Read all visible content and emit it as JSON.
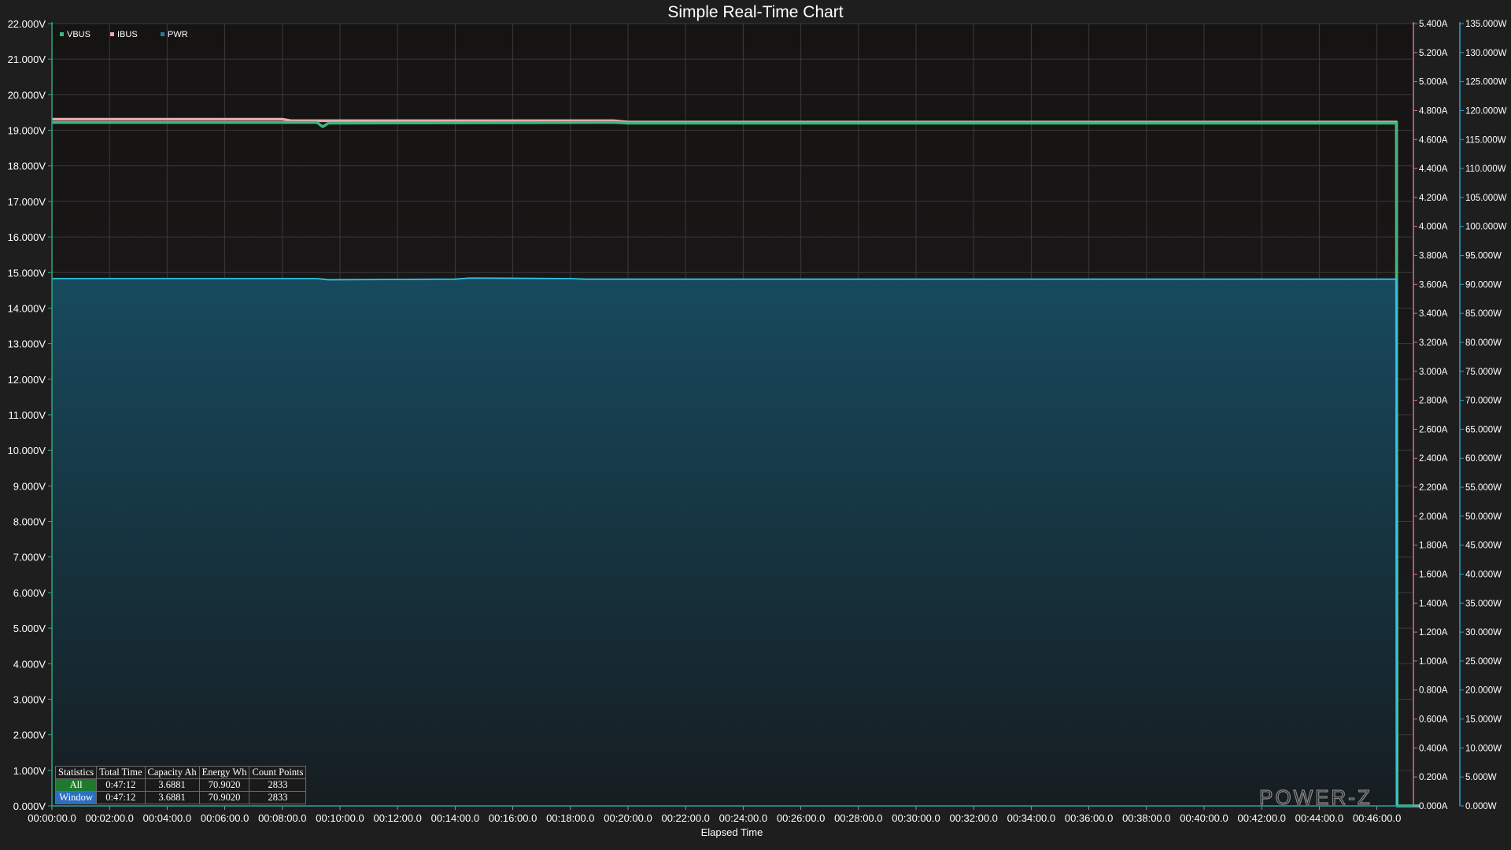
{
  "window": {
    "title": "Simple Real-Time Chart"
  },
  "colors": {
    "background": "#1e1e1e",
    "plot_background_top": "#161313",
    "vbus": "#3db87a",
    "ibus": "#e8a8b4",
    "pwr": "#33c4e8",
    "pwr_fill": "#1a5a70",
    "left_axis": "#2aa880",
    "right_axis_a": "#d07090",
    "right_axis_w": "#2aa0d0"
  },
  "chart_data": {
    "type": "area",
    "title": "Simple Real-Time Chart",
    "xlabel": "Elapsed Time",
    "ylabel": "",
    "x_ticks": [
      "00:00:00.0",
      "00:02:00.0",
      "00:04:00.0",
      "00:06:00.0",
      "00:08:00.0",
      "00:10:00.0",
      "00:12:00.0",
      "00:14:00.0",
      "00:16:00.0",
      "00:18:00.0",
      "00:20:00.0",
      "00:22:00.0",
      "00:24:00.0",
      "00:26:00.0",
      "00:28:00.0",
      "00:30:00.0",
      "00:32:00.0",
      "00:34:00.0",
      "00:36:00.0",
      "00:38:00.0",
      "00:40:00.0",
      "00:42:00.0",
      "00:44:00.0",
      "00:46:00.0"
    ],
    "x_range_minutes": [
      0,
      47.5
    ],
    "grid": true,
    "legend_position": "top-left",
    "y_axes": [
      {
        "id": "voltage",
        "side": "left",
        "unit": "V",
        "range": [
          0,
          22
        ],
        "ticks": [
          "0.000V",
          "1.000V",
          "2.000V",
          "3.000V",
          "4.000V",
          "5.000V",
          "6.000V",
          "7.000V",
          "8.000V",
          "9.000V",
          "10.000V",
          "11.000V",
          "12.000V",
          "13.000V",
          "14.000V",
          "15.000V",
          "16.000V",
          "17.000V",
          "18.000V",
          "19.000V",
          "20.000V",
          "21.000V",
          "22.000V"
        ]
      },
      {
        "id": "current",
        "side": "right",
        "unit": "A",
        "range": [
          0,
          5.4
        ],
        "ticks": [
          "0.000A",
          "0.200A",
          "0.400A",
          "0.600A",
          "0.800A",
          "1.000A",
          "1.200A",
          "1.400A",
          "1.600A",
          "1.800A",
          "2.000A",
          "2.200A",
          "2.400A",
          "2.600A",
          "2.800A",
          "3.000A",
          "3.200A",
          "3.400A",
          "3.600A",
          "3.800A",
          "4.000A",
          "4.200A",
          "4.400A",
          "4.600A",
          "4.800A",
          "5.000A",
          "5.200A",
          "5.400A"
        ]
      },
      {
        "id": "power",
        "side": "right",
        "unit": "W",
        "range": [
          0,
          135
        ],
        "ticks": [
          "0.000W",
          "5.000W",
          "10.000W",
          "15.000W",
          "20.000W",
          "25.000W",
          "30.000W",
          "35.000W",
          "40.000W",
          "45.000W",
          "50.000W",
          "55.000W",
          "60.000W",
          "65.000W",
          "70.000W",
          "75.000W",
          "80.000W",
          "85.000W",
          "90.000W",
          "95.000W",
          "100.000W",
          "105.000W",
          "110.000W",
          "115.000W",
          "120.000W",
          "125.000W",
          "130.000W",
          "135.000W"
        ]
      }
    ],
    "series": [
      {
        "name": "VBUS",
        "axis": "voltage",
        "x": [
          0,
          9.2,
          9.4,
          9.6,
          19.5,
          20,
          46.68,
          46.7,
          47.5
        ],
        "values": [
          19.22,
          19.22,
          19.1,
          19.2,
          19.22,
          19.2,
          19.2,
          0,
          0
        ]
      },
      {
        "name": "IBUS",
        "axis": "current",
        "x": [
          0,
          8,
          8.3,
          19.5,
          20,
          46.68,
          46.7,
          47.5
        ],
        "values": [
          4.74,
          4.74,
          4.73,
          4.73,
          4.72,
          4.72,
          0,
          0
        ]
      },
      {
        "name": "PWR",
        "axis": "power",
        "x": [
          0,
          9.2,
          9.6,
          14,
          14.5,
          18,
          18.5,
          46.68,
          46.7,
          47.5
        ],
        "values": [
          91.0,
          91.0,
          90.8,
          90.9,
          91.1,
          91.0,
          90.9,
          90.9,
          0,
          0
        ]
      }
    ]
  },
  "legend": {
    "items": [
      {
        "label": "VBUS",
        "color": "#3db87a"
      },
      {
        "label": "IBUS",
        "color": "#e8a8b4"
      },
      {
        "label": "PWR",
        "color": "#2a7aa0"
      }
    ]
  },
  "stats": {
    "headers": [
      "Statistics",
      "Total Time",
      "Capacity Ah",
      "Energy Wh",
      "Count Points"
    ],
    "rows": [
      {
        "label": "All",
        "total_time": "0:47:12",
        "capacity": "3.6881",
        "energy": "70.9020",
        "count": "2833"
      },
      {
        "label": "Window",
        "total_time": "0:47:12",
        "capacity": "3.6881",
        "energy": "70.9020",
        "count": "2833"
      }
    ]
  },
  "watermark": {
    "text": "POWER-Z"
  }
}
